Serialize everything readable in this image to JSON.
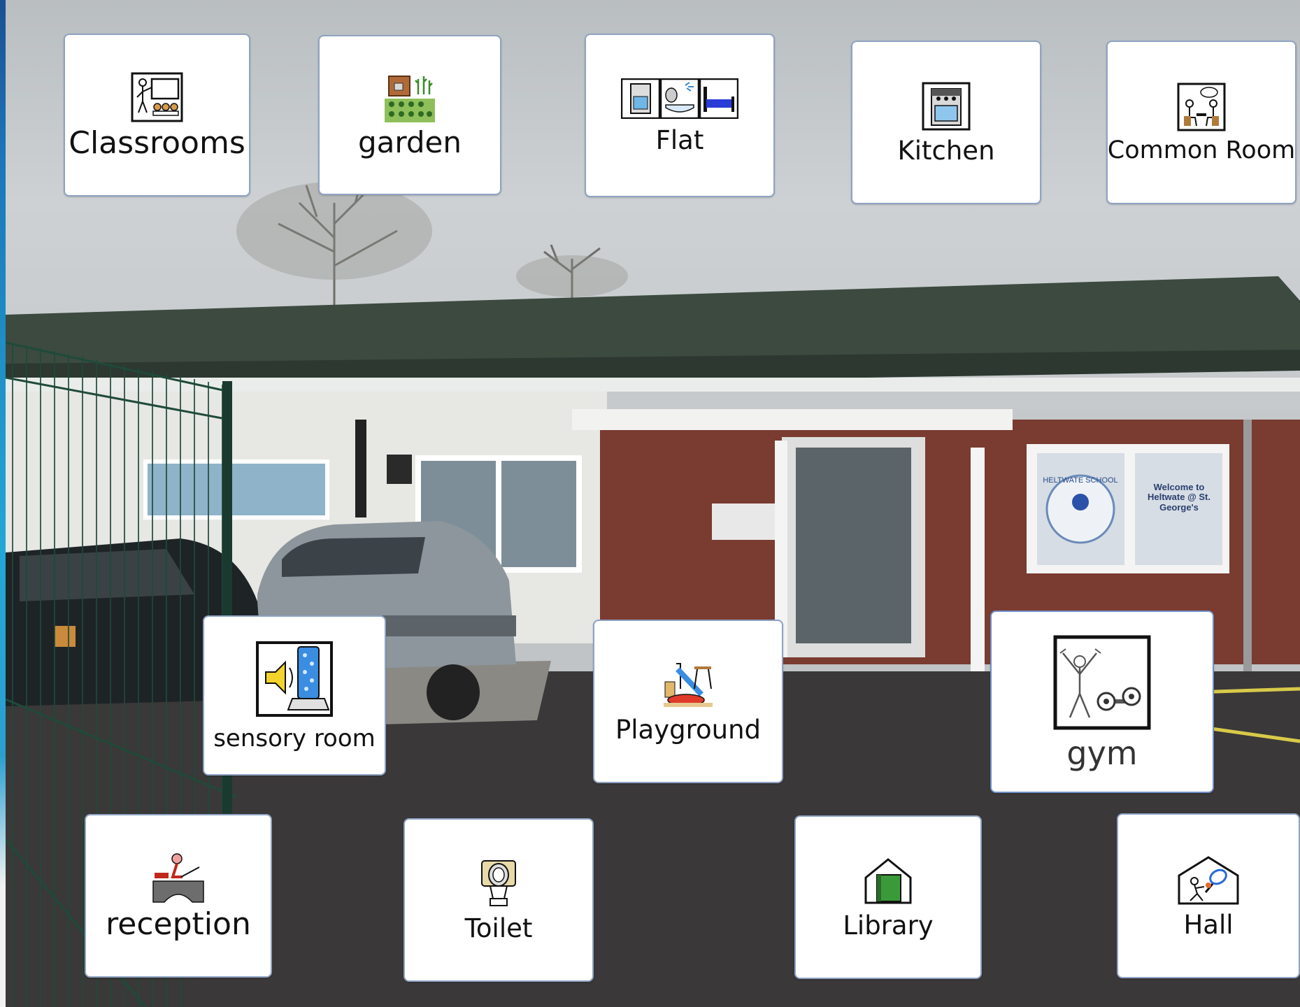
{
  "buttons": [
    {
      "id": "classrooms",
      "label": "Classrooms",
      "icon": "classroom-icon"
    },
    {
      "id": "garden",
      "label": "garden",
      "icon": "garden-icon"
    },
    {
      "id": "flat",
      "label": "Flat",
      "icon": "flat-icon"
    },
    {
      "id": "kitchen",
      "label": "Kitchen",
      "icon": "cooker-icon"
    },
    {
      "id": "common-room",
      "label": "Common Room",
      "icon": "common-room-icon"
    },
    {
      "id": "sensory-room",
      "label": "sensory room",
      "icon": "sensory-room-icon"
    },
    {
      "id": "playground",
      "label": "Playground",
      "icon": "playground-icon"
    },
    {
      "id": "gym",
      "label": "gym",
      "icon": "gym-icon"
    },
    {
      "id": "reception",
      "label": "reception",
      "icon": "reception-icon"
    },
    {
      "id": "toilet",
      "label": "Toilet",
      "icon": "toilet-icon"
    },
    {
      "id": "library",
      "label": "Library",
      "icon": "library-icon"
    },
    {
      "id": "hall",
      "label": "Hall",
      "icon": "hall-icon"
    }
  ],
  "sign": {
    "logo_text": "HELTWATE SCHOOL",
    "welcome_text": "Welcome to Heltwate @ St. George's"
  },
  "colors": {
    "card_border": "#8fa3c4",
    "card_bg": "#ffffff",
    "roof": "#3c4a40",
    "brick": "#7a3b30",
    "tarmac": "#3a3838"
  }
}
